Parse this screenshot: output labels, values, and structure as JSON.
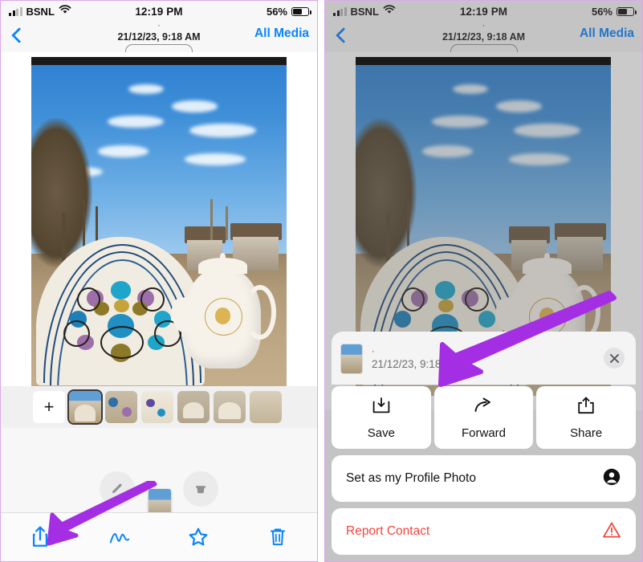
{
  "status_bar": {
    "carrier": "BSNL",
    "time": "12:19 PM",
    "battery_percent": "56%",
    "signal_icon": "signal-bars-icon",
    "wifi_icon": "wifi-icon",
    "battery_icon": "battery-icon"
  },
  "nav_bar": {
    "back_icon": "chevron-left-icon",
    "title_dot": "·",
    "date": "21/12/23, 9:18 AM",
    "right_label": "All Media"
  },
  "thumbnails": {
    "add_label": "+",
    "count": 6
  },
  "toolbar": {
    "items": [
      {
        "name": "share-icon",
        "label": "Share"
      },
      {
        "name": "markup-icon",
        "label": "Markup"
      },
      {
        "name": "star-icon",
        "label": "Star"
      },
      {
        "name": "trash-icon",
        "label": "Delete"
      }
    ]
  },
  "ghost_buttons": [
    {
      "name": "edit-pencil-icon"
    },
    {
      "name": "delete-icon"
    }
  ],
  "action_sheet": {
    "header": {
      "dot": "·",
      "date": "21/12/23, 9:18 AM",
      "close_icon": "close-icon",
      "thumbnail": "photo-thumbnail"
    },
    "actions": [
      {
        "label": "Save",
        "icon": "save-download-icon"
      },
      {
        "label": "Forward",
        "icon": "forward-arrow-icon"
      },
      {
        "label": "Share",
        "icon": "share-upload-icon"
      }
    ],
    "rows": [
      {
        "label": "Set as my Profile Photo",
        "icon": "person-circle-icon",
        "danger": false
      },
      {
        "label": "Report Contact",
        "icon": "warning-triangle-icon",
        "danger": true
      }
    ]
  },
  "annotations": {
    "arrow_color": "#a42ee4",
    "arrows": [
      {
        "name": "arrow-to-share-button",
        "panel": "left"
      },
      {
        "name": "arrow-to-save-button",
        "panel": "right"
      }
    ]
  },
  "colors": {
    "accent_blue": "#0a84ff",
    "danger_red": "#f4453c",
    "panel_border": "#dda6ee",
    "sheet_bg": "#f4f4f5"
  }
}
